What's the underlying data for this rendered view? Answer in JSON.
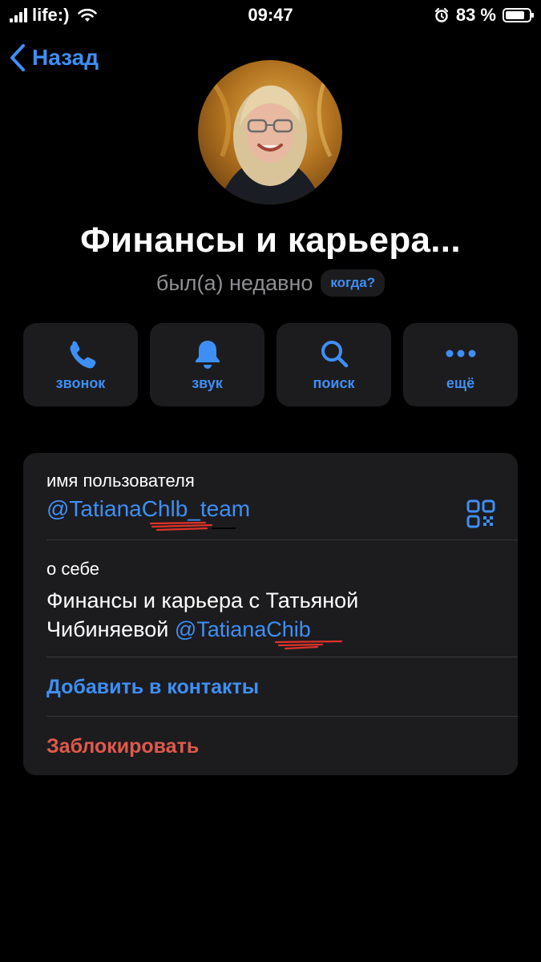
{
  "status_bar": {
    "carrier": "life:)",
    "time": "09:47",
    "battery": "83 %",
    "battery_level": 0.83
  },
  "nav": {
    "back_label": "Назад"
  },
  "profile": {
    "name": "Финансы и карьера...",
    "last_seen": "был(а) недавно",
    "when_label": "когда?"
  },
  "actions": [
    {
      "label": "звонок",
      "icon": "phone-icon"
    },
    {
      "label": "звук",
      "icon": "bell-icon"
    },
    {
      "label": "поиск",
      "icon": "search-icon"
    },
    {
      "label": "ещё",
      "icon": "more-icon"
    }
  ],
  "info": {
    "username_label": "имя пользователя",
    "username": "@TatianaChlb_team",
    "bio_label": "о себе",
    "bio_text": "Финансы и карьера с Татьяной Чибиняевой ",
    "bio_link": "@TatianaChib",
    "add_contact": "Добавить в контакты",
    "block": "Заблокировать"
  },
  "colors": {
    "accent": "#3e8ff5",
    "danger": "#e0594b",
    "card": "#1c1c1e",
    "background": "#000000"
  }
}
